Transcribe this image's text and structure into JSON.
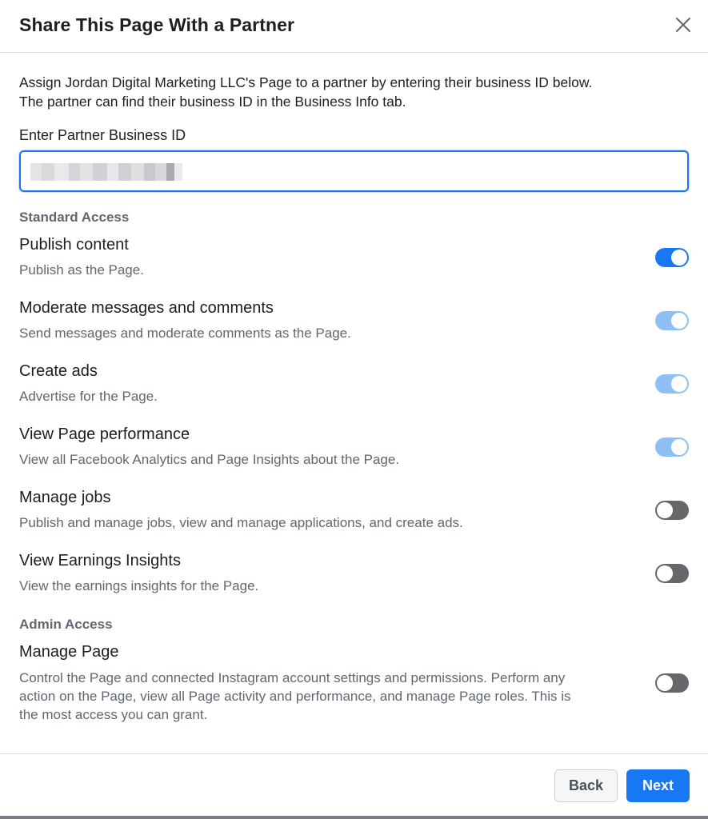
{
  "dialog": {
    "title": "Share This Page With a Partner",
    "close_icon": "close-icon",
    "intro_line1": "Assign Jordan Digital Marketing LLC's Page to a partner by entering their business ID below.",
    "intro_line2": "The partner can find their business ID in the Business Info tab.",
    "field_label": "Enter Partner Business ID",
    "field_value": ""
  },
  "standard_access": {
    "title": "Standard Access",
    "permissions": [
      {
        "title": "Publish content",
        "description": "Publish as the Page.",
        "state": "on"
      },
      {
        "title": "Moderate messages and comments",
        "description": "Send messages and moderate comments as the Page.",
        "state": "on-disabled"
      },
      {
        "title": "Create ads",
        "description": "Advertise for the Page.",
        "state": "on-disabled"
      },
      {
        "title": "View Page performance",
        "description": "View all Facebook Analytics and Page Insights about the Page.",
        "state": "on-disabled"
      },
      {
        "title": "Manage jobs",
        "description": "Publish and manage jobs, view and manage applications, and create ads.",
        "state": "off"
      },
      {
        "title": "View Earnings Insights",
        "description": "View the earnings insights for the Page.",
        "state": "off"
      }
    ]
  },
  "admin_access": {
    "title": "Admin Access",
    "permission": {
      "title": "Manage Page",
      "description_line1": "Control the Page and connected Instagram account settings and permissions. Perform any",
      "description_line2": "action on the Page, view all Page activity and performance, and manage Page roles. This is",
      "description_line3": "the most access you can grant.",
      "state": "off"
    }
  },
  "footer": {
    "back_label": "Back",
    "next_label": "Next"
  },
  "colors": {
    "accent": "#1877f2",
    "toggle_on": "#1877f2",
    "toggle_on_disabled": "#8ec0f5",
    "toggle_off": "#65676b",
    "secondary_text": "#606770"
  }
}
